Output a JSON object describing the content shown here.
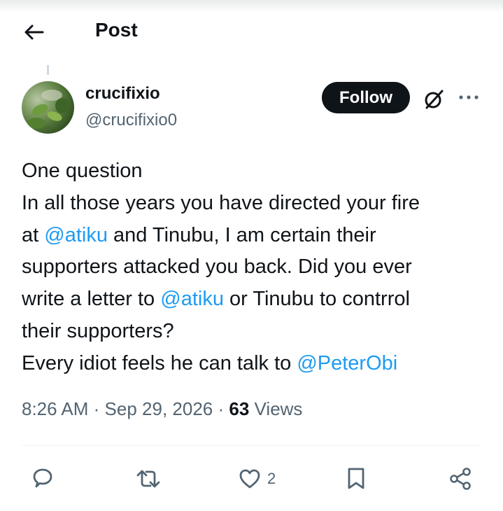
{
  "header": {
    "title": "Post"
  },
  "author": {
    "display_name": "crucifixio",
    "handle": "@crucifixio0"
  },
  "follow_label": "Follow",
  "tweet": {
    "lines": [
      [
        "One question"
      ],
      [
        "In all those years you have directed your fire"
      ],
      [
        "at ",
        {
          "mention": "@atiku"
        },
        " and Tinubu, I am certain their"
      ],
      [
        "supporters attacked you back. Did you ever"
      ],
      [
        "write a letter to ",
        {
          "mention": "@atiku"
        },
        " or Tinubu to contrrol"
      ],
      [
        "their supporters?"
      ],
      [
        "Every idiot feels he can talk to ",
        {
          "mention": "@PeterObi"
        }
      ]
    ]
  },
  "meta": {
    "time": "8:26 AM",
    "separator": "·",
    "date": "Sep 29, 2026",
    "views_count": "63",
    "views_label": "Views"
  },
  "actions": {
    "like_count": "2"
  },
  "icons": {
    "back": "arrow-left-icon",
    "grok": "grok-icon",
    "more": "more-icon",
    "reply": "reply-icon",
    "repost": "repost-icon",
    "like": "heart-icon",
    "bookmark": "bookmark-icon",
    "share": "share-icon"
  },
  "colors": {
    "text": "#0f1419",
    "secondary": "#536471",
    "link": "#1d9bf0",
    "button_bg": "#0f1419"
  }
}
